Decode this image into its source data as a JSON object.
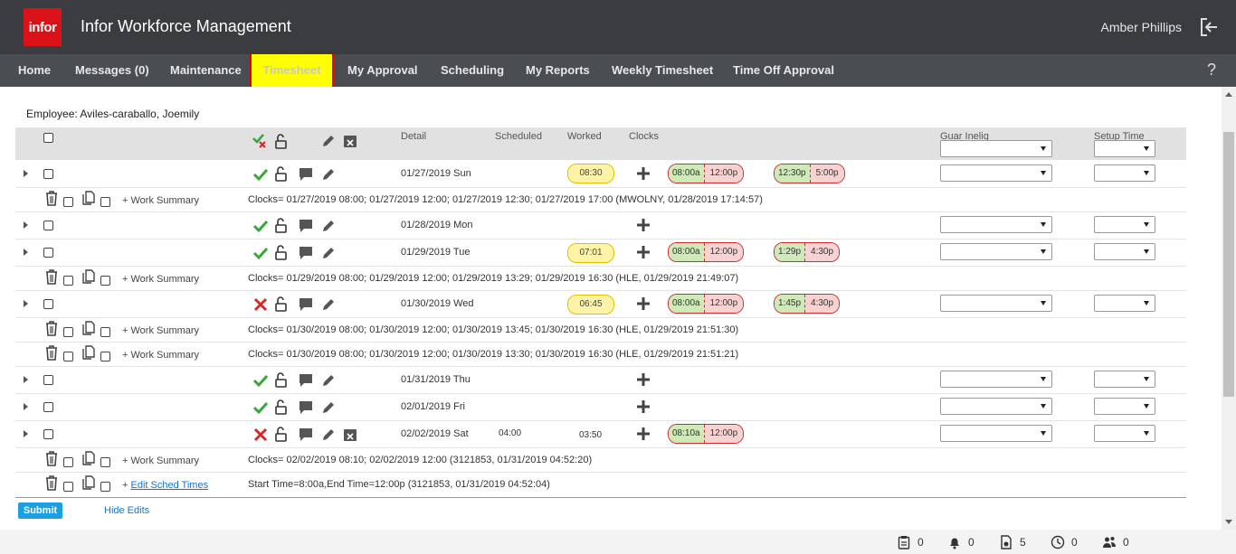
{
  "app": {
    "logo": "infor",
    "title": "Infor Workforce Management",
    "user": "Amber Phillips"
  },
  "nav": {
    "items": [
      {
        "label": "Home"
      },
      {
        "label": "Messages (0)"
      },
      {
        "label": "Maintenance"
      },
      {
        "label": "Timesheet",
        "active": true
      },
      {
        "label": "My Approval"
      },
      {
        "label": "Scheduling"
      },
      {
        "label": "My Reports"
      },
      {
        "label": "Weekly Timesheet"
      },
      {
        "label": "Time Off Approval"
      }
    ],
    "help": "?"
  },
  "employee": "Employee: Aviles-caraballo, Joemily",
  "columns": {
    "detail": "Detail",
    "scheduled": "Scheduled",
    "worked": "Worked",
    "clocks": "Clocks",
    "guar_inelig": "Guar Inelig",
    "setup_time": "Setup Time"
  },
  "days": [
    {
      "date": "01/27/2019 Sun",
      "status": "approved",
      "worked": "08:30",
      "clocks": [
        [
          "08:00a",
          "12:00p"
        ],
        [
          "12:30p",
          "5:00p"
        ]
      ]
    },
    {
      "date": "01/28/2019 Mon",
      "status": "approved",
      "worked": "",
      "clocks": []
    },
    {
      "date": "01/29/2019 Tue",
      "status": "approved",
      "worked": "07:01",
      "clocks": [
        [
          "08:00a",
          "12:00p"
        ],
        [
          "1:29p",
          "4:30p"
        ]
      ]
    },
    {
      "date": "01/30/2019 Wed",
      "status": "rejected",
      "worked": "06:45",
      "clocks": [
        [
          "08:00a",
          "12:00p"
        ],
        [
          "1:45p",
          "4:30p"
        ]
      ]
    },
    {
      "date": "01/31/2019 Thu",
      "status": "approved",
      "worked": "",
      "clocks": []
    },
    {
      "date": "02/01/2019 Fri",
      "status": "approved",
      "worked": "",
      "clocks": []
    },
    {
      "date": "02/02/2019 Sat",
      "status": "rejected",
      "scheduled": "04:00",
      "worked": "03:50",
      "clocks": [
        [
          "08:10a",
          "12:00p"
        ]
      ]
    }
  ],
  "edits": [
    {
      "label": "+ Work Summary",
      "text": "Clocks= 01/27/2019 08:00; 01/27/2019 12:00; 01/27/2019 12:30; 01/27/2019 17:00 (MWOLNY, 01/28/2019 17:14:57)"
    },
    {
      "label": "+ Work Summary",
      "text": "Clocks= 01/29/2019 08:00; 01/29/2019 12:00; 01/29/2019 13:29; 01/29/2019 16:30 (HLE, 01/29/2019 21:49:07)"
    },
    {
      "label": "+ Work Summary",
      "text": "Clocks= 01/30/2019 08:00; 01/30/2019 12:00; 01/30/2019 13:45; 01/30/2019 16:30 (HLE, 01/29/2019 21:51:30)"
    },
    {
      "label": "+ Work Summary",
      "text": "Clocks= 01/30/2019 08:00; 01/30/2019 12:00; 01/30/2019 13:30; 01/30/2019 16:30 (HLE, 01/29/2019 21:51:21)"
    },
    {
      "label": "+ Work Summary",
      "text": "Clocks= 02/02/2019 08:10; 02/02/2019 12:00 (3121853, 01/31/2019 04:52:20)"
    },
    {
      "label_prefix": "+ ",
      "label_link": "Edit Sched Times",
      "text": "Start Time=8:00a,End Time=12:00p (3121853, 01/31/2019 04:52:04)"
    }
  ],
  "actions": {
    "submit": "Submit",
    "hide_edits": "Hide Edits"
  },
  "footer": {
    "tasks": "0",
    "alerts": "0",
    "documents": "5",
    "timeoff": "0",
    "team": "0"
  },
  "colors": {
    "topbar": "#3a3c40",
    "nav": "#4a4d52",
    "active_tab": "#ffff00",
    "logo": "#da1217",
    "accent": "#1a9fe3"
  }
}
